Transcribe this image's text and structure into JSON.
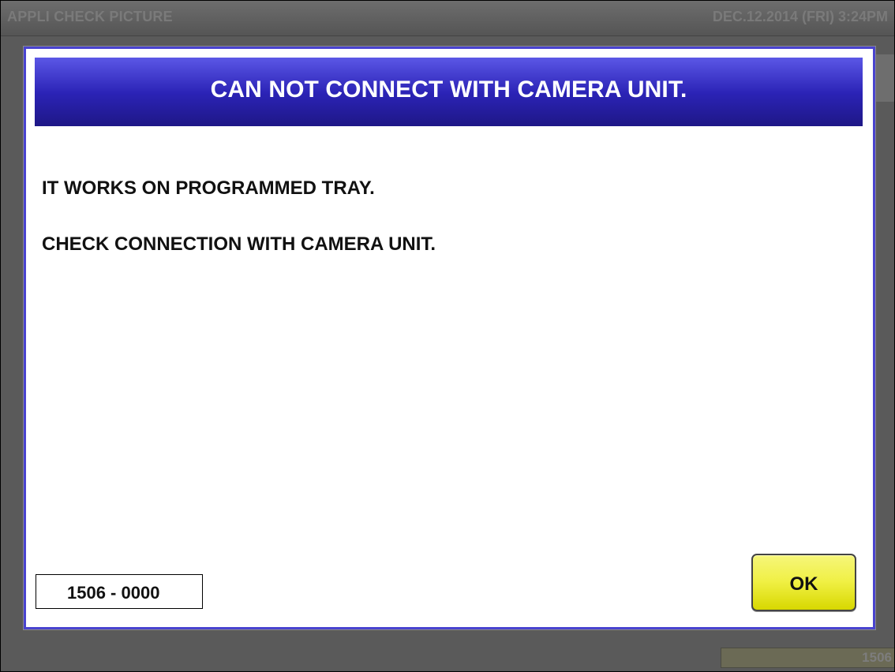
{
  "app": {
    "title": "APPLI CHECK PICTURE",
    "datetime": "DEC.12.2014 (FRI)  3:24PM"
  },
  "background": {
    "bottom_value": "1506"
  },
  "dialog": {
    "title": "CAN NOT CONNECT WITH CAMERA UNIT.",
    "messages": [
      "IT WORKS ON PROGRAMMED TRAY.",
      "CHECK CONNECTION WITH CAMERA UNIT."
    ],
    "code": "1506 - 0000",
    "ok_label": "OK"
  },
  "colors": {
    "dialog_border": "#4943cf",
    "header_top": "#5b57e6",
    "header_bottom": "#1e1786",
    "ok_button": "#f0f045"
  }
}
